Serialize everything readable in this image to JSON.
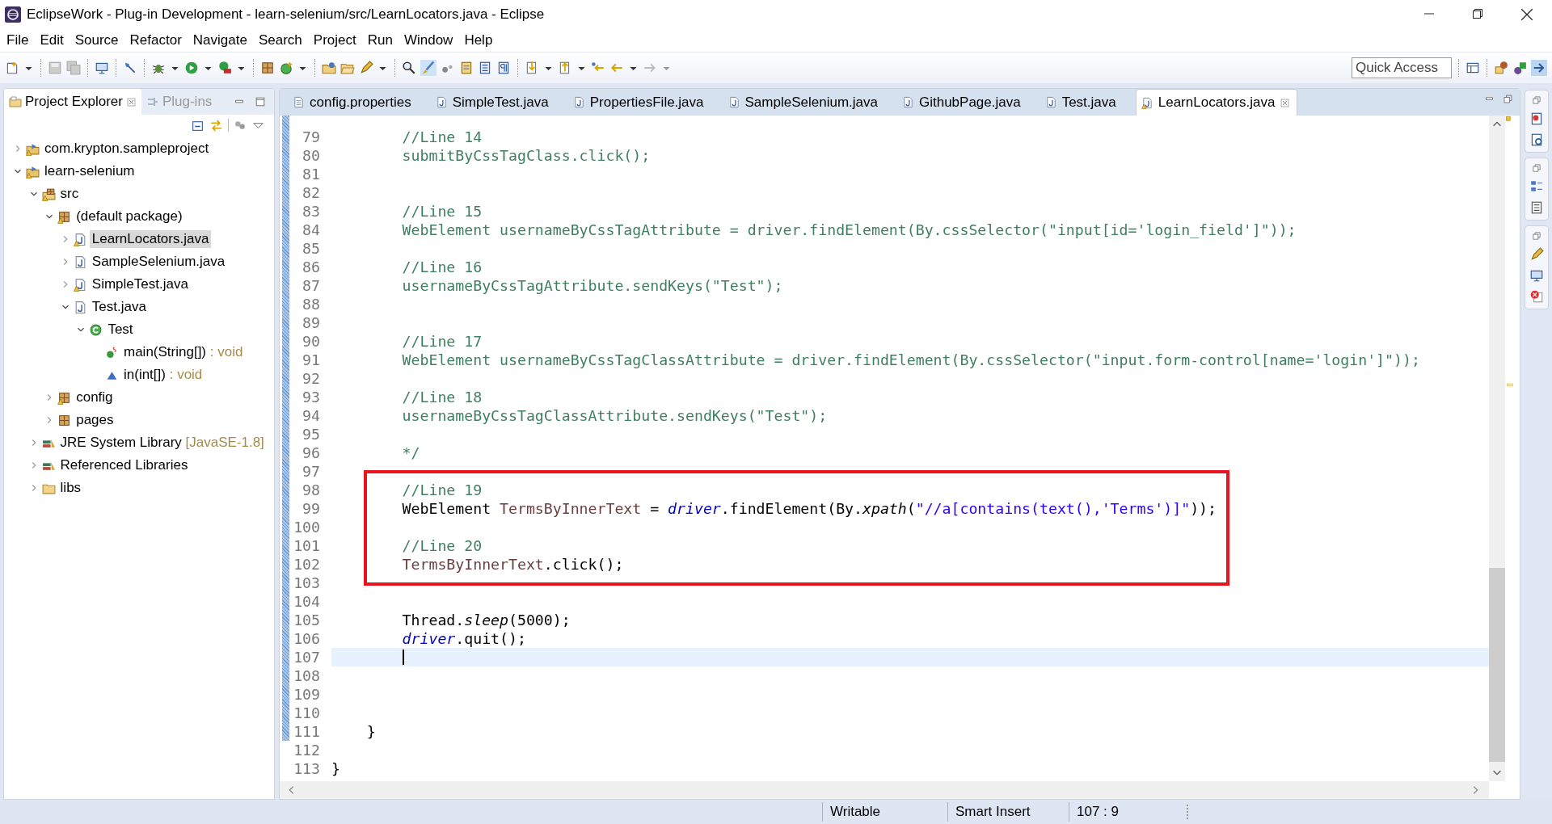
{
  "window": {
    "title": "EclipseWork - Plug-in Development - learn-selenium/src/LearnLocators.java - Eclipse"
  },
  "menu": [
    "File",
    "Edit",
    "Source",
    "Refactor",
    "Navigate",
    "Search",
    "Project",
    "Run",
    "Window",
    "Help"
  ],
  "quick_access": {
    "placeholder": "Quick Access"
  },
  "explorer": {
    "tabs": [
      {
        "label": "Project Explorer",
        "selected": true
      },
      {
        "label": "Plug-ins",
        "selected": false
      }
    ],
    "tree": [
      {
        "label": "com.krypton.sampleproject",
        "kind": "project",
        "expanded": false,
        "selected": false,
        "warning": true
      },
      {
        "label": "learn-selenium",
        "kind": "project",
        "expanded": true,
        "selected": false,
        "warning": true,
        "children": [
          {
            "label": "src",
            "kind": "source-folder",
            "expanded": true,
            "selected": false,
            "warning": true,
            "children": [
              {
                "label": "(default package)",
                "kind": "package",
                "expanded": true,
                "selected": false,
                "warning": true,
                "children": [
                  {
                    "label": "LearnLocators.java",
                    "kind": "java-file",
                    "expanded": false,
                    "selected": true,
                    "warning": true
                  },
                  {
                    "label": "SampleSelenium.java",
                    "kind": "java-file",
                    "expanded": false,
                    "selected": false,
                    "warning": false
                  },
                  {
                    "label": "SimpleTest.java",
                    "kind": "java-file",
                    "expanded": false,
                    "selected": false,
                    "warning": true
                  },
                  {
                    "label": "Test.java",
                    "kind": "java-file",
                    "expanded": true,
                    "selected": false,
                    "warning": false,
                    "children": [
                      {
                        "label": "Test",
                        "kind": "class",
                        "expanded": true,
                        "selected": false,
                        "warning": false,
                        "children": [
                          {
                            "label": "main(String[])",
                            "suffix": " : void",
                            "kind": "static-method",
                            "selected": false,
                            "warning": false
                          },
                          {
                            "label": "in(int[])",
                            "suffix": " : void",
                            "kind": "method",
                            "selected": false,
                            "warning": false
                          }
                        ]
                      }
                    ]
                  }
                ]
              },
              {
                "label": "config",
                "kind": "package",
                "expanded": false,
                "selected": false,
                "warning": true
              },
              {
                "label": "pages",
                "kind": "package",
                "expanded": false,
                "selected": false,
                "warning": false
              }
            ]
          },
          {
            "label": "JRE System Library",
            "suffix": " [JavaSE-1.8]",
            "kind": "library",
            "expanded": false,
            "selected": false,
            "warning": false
          },
          {
            "label": "Referenced Libraries",
            "kind": "library",
            "expanded": false,
            "selected": false,
            "warning": false
          },
          {
            "label": "libs",
            "kind": "folder",
            "expanded": false,
            "selected": false,
            "warning": false
          }
        ]
      }
    ]
  },
  "editor": {
    "tabs": [
      {
        "label": "config.properties",
        "kind": "properties",
        "selected": false,
        "warning": false
      },
      {
        "label": "SimpleTest.java",
        "kind": "java",
        "selected": false,
        "warning": false
      },
      {
        "label": "PropertiesFile.java",
        "kind": "java",
        "selected": false,
        "warning": false
      },
      {
        "label": "SampleSelenium.java",
        "kind": "java",
        "selected": false,
        "warning": false
      },
      {
        "label": "GithubPage.java",
        "kind": "java",
        "selected": false,
        "warning": false
      },
      {
        "label": "Test.java",
        "kind": "java",
        "selected": false,
        "warning": false
      },
      {
        "label": "LearnLocators.java",
        "kind": "java",
        "selected": true,
        "warning": true
      }
    ],
    "blocks": [
      {
        "kind": "plain",
        "lines": [
          {
            "number": "79",
            "kind": "code",
            "tokens": [
              {
                "kind": "comment",
                "text": "        //Line 14"
              }
            ]
          },
          {
            "number": "80",
            "kind": "code",
            "tokens": [
              {
                "kind": "comment",
                "text": "        submitByCssTagClass.click();"
              }
            ]
          },
          {
            "number": "81",
            "kind": "code"
          },
          {
            "number": "82",
            "kind": "code"
          },
          {
            "number": "83",
            "kind": "code",
            "tokens": [
              {
                "kind": "comment",
                "text": "        //Line 15"
              }
            ]
          },
          {
            "number": "84",
            "kind": "code",
            "tokens": [
              {
                "kind": "comment",
                "text": "        WebElement usernameByCssTagAttribute = driver.findElement(By.cssSelector(\"input[id='login_field']\"));"
              }
            ]
          },
          {
            "number": "85",
            "kind": "code"
          },
          {
            "number": "86",
            "kind": "code",
            "tokens": [
              {
                "kind": "comment",
                "text": "        //Line 16"
              }
            ]
          },
          {
            "number": "87",
            "kind": "code",
            "tokens": [
              {
                "kind": "comment",
                "text": "        usernameByCssTagAttribute.sendKeys(\"Test\");"
              }
            ]
          },
          {
            "number": "88",
            "kind": "code"
          },
          {
            "number": "89",
            "kind": "code"
          },
          {
            "number": "90",
            "kind": "code",
            "tokens": [
              {
                "kind": "comment",
                "text": "        //Line 17"
              }
            ]
          },
          {
            "number": "91",
            "kind": "code",
            "tokens": [
              {
                "kind": "comment",
                "text": "        WebElement usernameByCssTagClassAttribute = driver.findElement(By.cssSelector(\"input.form-control[name='login']\"));"
              }
            ]
          },
          {
            "number": "92",
            "kind": "code"
          },
          {
            "number": "93",
            "kind": "code",
            "tokens": [
              {
                "kind": "comment",
                "text": "        //Line 18"
              }
            ]
          },
          {
            "number": "94",
            "kind": "code",
            "tokens": [
              {
                "kind": "comment",
                "text": "        usernameByCssTagClassAttribute.sendKeys(\"Test\");"
              }
            ]
          },
          {
            "number": "95",
            "kind": "code"
          },
          {
            "number": "96",
            "kind": "code",
            "tokens": [
              {
                "kind": "comment",
                "text": "        */"
              }
            ]
          }
        ]
      },
      {
        "kind": "highlight",
        "lines": [
          {
            "number": "97",
            "kind": "code"
          },
          {
            "number": "98",
            "kind": "code",
            "tokens": [
              {
                "kind": "comment",
                "text": "        //Line 19"
              }
            ]
          },
          {
            "number": "99",
            "kind": "code",
            "tokens": [
              {
                "kind": "plain",
                "text": "        WebElement "
              },
              {
                "kind": "local",
                "text": "TermsByInnerText"
              },
              {
                "kind": "plain",
                "text": " = "
              },
              {
                "kind": "field",
                "text": "driver"
              },
              {
                "kind": "plain",
                "text": ".findElement(By."
              },
              {
                "kind": "static",
                "text": "xpath"
              },
              {
                "kind": "plain",
                "text": "("
              },
              {
                "kind": "string",
                "text": "\"//a[contains(text(),'Terms')]\""
              },
              {
                "kind": "plain",
                "text": "));"
              }
            ]
          },
          {
            "number": "100",
            "kind": "code"
          },
          {
            "number": "101",
            "kind": "code",
            "tokens": [
              {
                "kind": "comment",
                "text": "        //Line 20"
              }
            ]
          },
          {
            "number": "102",
            "kind": "code",
            "tokens": [
              {
                "kind": "local",
                "text": "        TermsByInnerText"
              },
              {
                "kind": "plain",
                "text": ".click();"
              }
            ]
          },
          {
            "number": "103",
            "kind": "code"
          }
        ]
      },
      {
        "kind": "plain",
        "lines": [
          {
            "number": "104",
            "kind": "code"
          },
          {
            "number": "105",
            "kind": "code",
            "tokens": [
              {
                "kind": "plain",
                "text": "        Thread."
              },
              {
                "kind": "static",
                "text": "sleep"
              },
              {
                "kind": "plain",
                "text": "(5000);"
              }
            ]
          },
          {
            "number": "106",
            "kind": "code",
            "tokens": [
              {
                "kind": "field",
                "text": "        driver"
              },
              {
                "kind": "plain",
                "text": ".quit();"
              }
            ]
          },
          {
            "number": "107",
            "kind": "cursor"
          },
          {
            "number": "108",
            "kind": "code"
          },
          {
            "number": "109",
            "kind": "code"
          },
          {
            "number": "110",
            "kind": "code"
          },
          {
            "number": "111",
            "kind": "code",
            "tokens": [
              {
                "kind": "plain",
                "text": "    }"
              }
            ]
          },
          {
            "number": "112",
            "kind": "code"
          },
          {
            "number": "113",
            "kind": "code",
            "tokens": [
              {
                "kind": "plain",
                "text": "}"
              }
            ]
          }
        ]
      }
    ]
  },
  "status_bar": [
    "Writable",
    "Smart Insert",
    "107 : 9"
  ]
}
